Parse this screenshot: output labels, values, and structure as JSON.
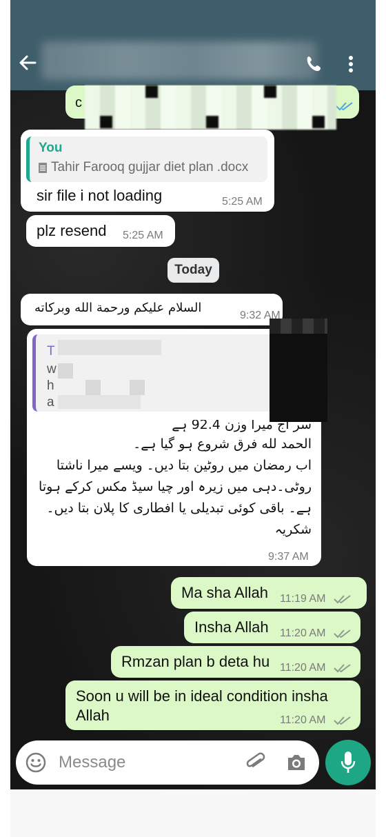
{
  "colors": {
    "header": "#3f5e6b",
    "outgoing_bubble": "#dcf8c6",
    "incoming_bubble": "#ffffff",
    "accent": "#1ea784",
    "read_ticks": "#4fa3e0"
  },
  "messages": {
    "top_partial": {
      "text": "c"
    },
    "reply_file": {
      "quote_name": "You",
      "quote_file": "Tahir Farooq gujjar diet plan .docx",
      "text": "sir file i not loading",
      "time": "5:25 AM"
    },
    "resend": {
      "text": "plz resend",
      "time": "5:25 AM"
    },
    "date_chip": "Today",
    "salam": {
      "text": "السلام علیکم ورحمة الله وبركاته",
      "time": "9:32 AM"
    },
    "long_msg": {
      "quote_chars": [
        "T",
        "w",
        "h",
        "a"
      ],
      "lines": [
        "سر اج میرا وزن 92.4 ہے",
        "الحمد لله فرق شروع ہو گیا ہے۔",
        "اب رمضان میں روٹین بتا دیں۔ ویسے میرا ناشتا",
        "روٹی۔دہی میں زیرہ اور چیا سیڈ مکس کرکے ہوتا",
        "ہے۔ باقی کوئی تبدیلی یا افطاری کا پلان بتا دیں۔",
        "شکریہ"
      ],
      "time": "9:37 AM"
    },
    "out1": {
      "text": "Ma sha Allah",
      "time": "11:19 AM"
    },
    "out2": {
      "text": "Insha Allah",
      "time": "11:20 AM"
    },
    "out3": {
      "text": "Rmzan plan b deta hu",
      "time": "11:20 AM"
    },
    "out4": {
      "text": "Soon u will be in ideal condition insha Allah",
      "time": "11:20 AM"
    }
  },
  "composer": {
    "placeholder": "Message"
  }
}
